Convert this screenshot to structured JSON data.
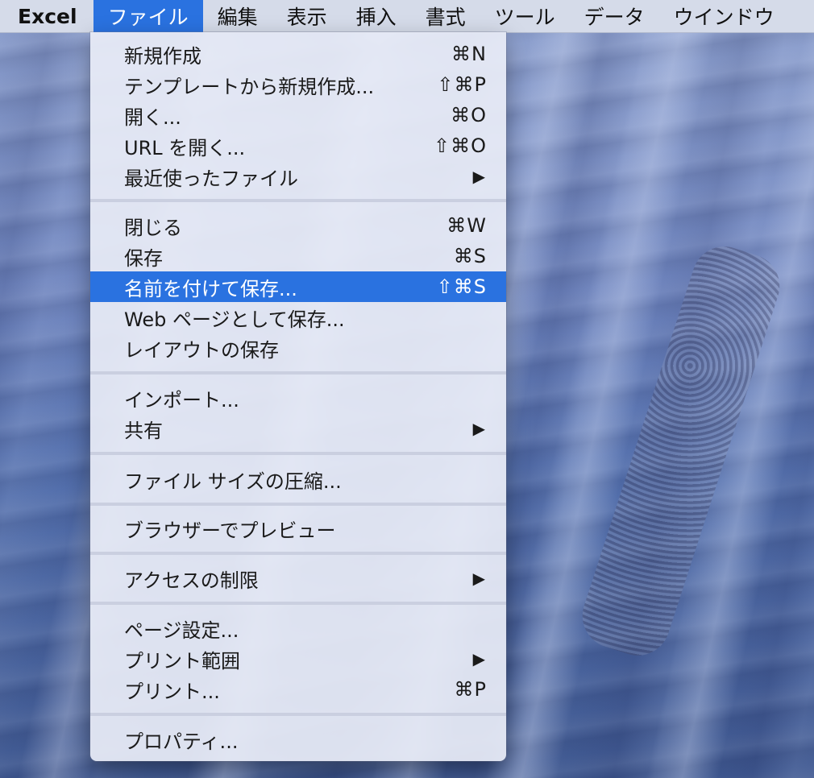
{
  "menubar": {
    "app_name": "Excel",
    "items": [
      "ファイル",
      "編集",
      "表示",
      "挿入",
      "書式",
      "ツール",
      "データ",
      "ウインドウ"
    ]
  },
  "file_menu": {
    "items": [
      {
        "label": "新規作成",
        "shortcut": "⌘N"
      },
      {
        "label": "テンプレートから新規作成...",
        "shortcut": "⇧⌘P"
      },
      {
        "label": "開く...",
        "shortcut": "⌘O"
      },
      {
        "label": "URL を開く...",
        "shortcut": "⇧⌘O"
      },
      {
        "label": "最近使ったファイル",
        "submenu_icon": "▶"
      },
      {
        "label": "閉じる",
        "shortcut": "⌘W"
      },
      {
        "label": "保存",
        "shortcut": "⌘S"
      },
      {
        "label": "名前を付けて保存...",
        "shortcut": "⇧⌘S",
        "highlighted": true
      },
      {
        "label": "Web ページとして保存..."
      },
      {
        "label": "レイアウトの保存"
      },
      {
        "label": "インポート..."
      },
      {
        "label": "共有",
        "submenu_icon": "▶"
      },
      {
        "label": "ファイル サイズの圧縮..."
      },
      {
        "label": "ブラウザーでプレビュー"
      },
      {
        "label": "アクセスの制限",
        "submenu_icon": "▶"
      },
      {
        "label": "ページ設定..."
      },
      {
        "label": "プリント範囲",
        "submenu_icon": "▶"
      },
      {
        "label": "プリント...",
        "shortcut": "⌘P"
      },
      {
        "label": "プロパティ..."
      }
    ]
  },
  "colors": {
    "highlight": "#2a72e0",
    "menubar_bg": "#e1e5f0",
    "menu_bg": "#e8ecf6"
  }
}
